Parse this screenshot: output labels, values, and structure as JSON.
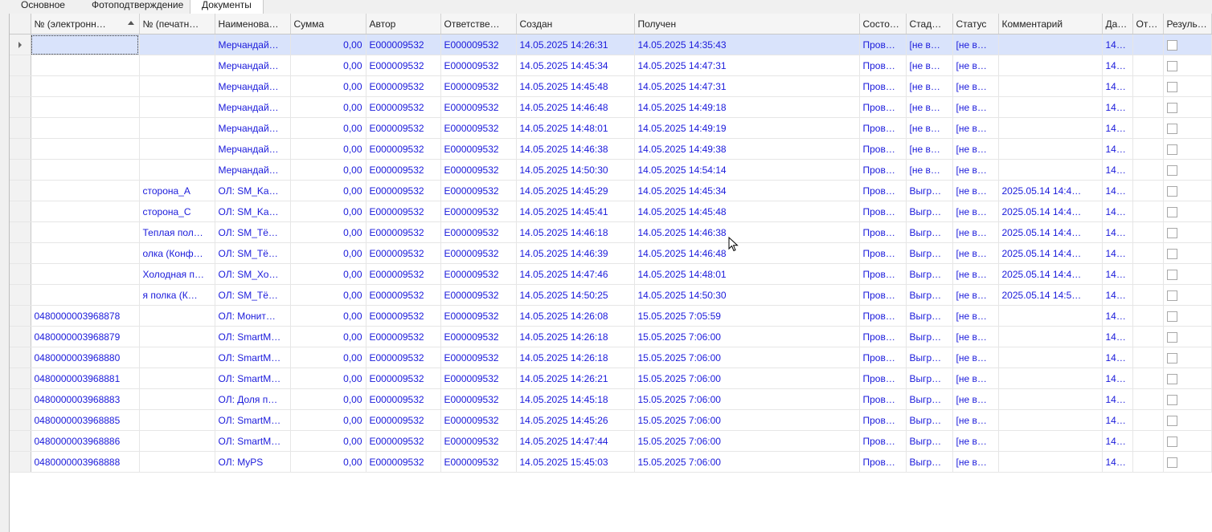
{
  "tabs": [
    {
      "label": "Основное"
    },
    {
      "label": "Фотоподтверждение"
    },
    {
      "label": "Документы"
    }
  ],
  "columns": [
    "№ (электронн…",
    "№ (печатн…",
    "Наименова…",
    "Сумма",
    "Автор",
    "Ответстве…",
    "Создан",
    "Получен",
    "Состо…",
    "Стад…",
    "Статус",
    "Комментарий",
    "Да…",
    "От…",
    "Резуль…"
  ],
  "rows": [
    {
      "e": "",
      "p": "",
      "name": "Мерчандай…",
      "sum": "0,00",
      "author": "E000009532",
      "resp": "E000009532",
      "created": "14.05.2025 14:26:31",
      "received": "14.05.2025 14:35:43",
      "state": "Пров…",
      "stage": "[не в…",
      "status": "[не в…",
      "comment": "",
      "date": "14…"
    },
    {
      "e": "",
      "p": "",
      "name": "Мерчандай…",
      "sum": "0,00",
      "author": "E000009532",
      "resp": "E000009532",
      "created": "14.05.2025 14:45:34",
      "received": "14.05.2025 14:47:31",
      "state": "Пров…",
      "stage": "[не в…",
      "status": "[не в…",
      "comment": "",
      "date": "14…"
    },
    {
      "e": "",
      "p": "",
      "name": "Мерчандай…",
      "sum": "0,00",
      "author": "E000009532",
      "resp": "E000009532",
      "created": "14.05.2025 14:45:48",
      "received": "14.05.2025 14:47:31",
      "state": "Пров…",
      "stage": "[не в…",
      "status": "[не в…",
      "comment": "",
      "date": "14…"
    },
    {
      "e": "",
      "p": "",
      "name": "Мерчандай…",
      "sum": "0,00",
      "author": "E000009532",
      "resp": "E000009532",
      "created": "14.05.2025 14:46:48",
      "received": "14.05.2025 14:49:18",
      "state": "Пров…",
      "stage": "[не в…",
      "status": "[не в…",
      "comment": "",
      "date": "14…"
    },
    {
      "e": "",
      "p": "",
      "name": "Мерчандай…",
      "sum": "0,00",
      "author": "E000009532",
      "resp": "E000009532",
      "created": "14.05.2025 14:48:01",
      "received": "14.05.2025 14:49:19",
      "state": "Пров…",
      "stage": "[не в…",
      "status": "[не в…",
      "comment": "",
      "date": "14…"
    },
    {
      "e": "",
      "p": "",
      "name": "Мерчандай…",
      "sum": "0,00",
      "author": "E000009532",
      "resp": "E000009532",
      "created": "14.05.2025 14:46:38",
      "received": "14.05.2025 14:49:38",
      "state": "Пров…",
      "stage": "[не в…",
      "status": "[не в…",
      "comment": "",
      "date": "14…"
    },
    {
      "e": "",
      "p": "",
      "name": "Мерчандай…",
      "sum": "0,00",
      "author": "E000009532",
      "resp": "E000009532",
      "created": "14.05.2025 14:50:30",
      "received": "14.05.2025 14:54:14",
      "state": "Пров…",
      "stage": "[не в…",
      "status": "[не в…",
      "comment": "",
      "date": "14…"
    },
    {
      "e": "",
      "p": "сторона_А",
      "name": "ОЛ: SM_Ka…",
      "sum": "0,00",
      "author": "E000009532",
      "resp": "E000009532",
      "created": "14.05.2025 14:45:29",
      "received": "14.05.2025 14:45:34",
      "state": "Пров…",
      "stage": "Выгр…",
      "status": "[не в…",
      "comment": "2025.05.14 14:4…",
      "date": "14…"
    },
    {
      "e": "",
      "p": "сторона_С",
      "name": "ОЛ: SM_Ka…",
      "sum": "0,00",
      "author": "E000009532",
      "resp": "E000009532",
      "created": "14.05.2025 14:45:41",
      "received": "14.05.2025 14:45:48",
      "state": "Пров…",
      "stage": "Выгр…",
      "status": "[не в…",
      "comment": "2025.05.14 14:4…",
      "date": "14…"
    },
    {
      "e": "",
      "p": "Теплая пол…",
      "name": "ОЛ: SM_Тё…",
      "sum": "0,00",
      "author": "E000009532",
      "resp": "E000009532",
      "created": "14.05.2025 14:46:18",
      "received": "14.05.2025 14:46:38",
      "state": "Пров…",
      "stage": "Выгр…",
      "status": "[не в…",
      "comment": "2025.05.14 14:4…",
      "date": "14…"
    },
    {
      "e": "",
      "p": "олка (Конф…",
      "name": "ОЛ: SM_Тё…",
      "sum": "0,00",
      "author": "E000009532",
      "resp": "E000009532",
      "created": "14.05.2025 14:46:39",
      "received": "14.05.2025 14:46:48",
      "state": "Пров…",
      "stage": "Выгр…",
      "status": "[не в…",
      "comment": "2025.05.14 14:4…",
      "date": "14…"
    },
    {
      "e": "",
      "p": "Холодная п…",
      "name": "ОЛ: SM_Хо…",
      "sum": "0,00",
      "author": "E000009532",
      "resp": "E000009532",
      "created": "14.05.2025 14:47:46",
      "received": "14.05.2025 14:48:01",
      "state": "Пров…",
      "stage": "Выгр…",
      "status": "[не в…",
      "comment": "2025.05.14 14:4…",
      "date": "14…"
    },
    {
      "e": "",
      "p": "я полка (К…",
      "name": "ОЛ: SM_Тё…",
      "sum": "0,00",
      "author": "E000009532",
      "resp": "E000009532",
      "created": "14.05.2025 14:50:25",
      "received": "14.05.2025 14:50:30",
      "state": "Пров…",
      "stage": "Выгр…",
      "status": "[не в…",
      "comment": "2025.05.14 14:5…",
      "date": "14…"
    },
    {
      "e": "0480000003968878",
      "p": "",
      "name": "ОЛ: Монит…",
      "sum": "0,00",
      "author": "E000009532",
      "resp": "E000009532",
      "created": "14.05.2025 14:26:08",
      "received": "15.05.2025 7:05:59",
      "state": "Пров…",
      "stage": "Выгр…",
      "status": "[не в…",
      "comment": "",
      "date": "14…"
    },
    {
      "e": "0480000003968879",
      "p": "",
      "name": "ОЛ: SmartM…",
      "sum": "0,00",
      "author": "E000009532",
      "resp": "E000009532",
      "created": "14.05.2025 14:26:18",
      "received": "15.05.2025 7:06:00",
      "state": "Пров…",
      "stage": "Выгр…",
      "status": "[не в…",
      "comment": "",
      "date": "14…"
    },
    {
      "e": "0480000003968880",
      "p": "",
      "name": "ОЛ: SmartM…",
      "sum": "0,00",
      "author": "E000009532",
      "resp": "E000009532",
      "created": "14.05.2025 14:26:18",
      "received": "15.05.2025 7:06:00",
      "state": "Пров…",
      "stage": "Выгр…",
      "status": "[не в…",
      "comment": "",
      "date": "14…"
    },
    {
      "e": "0480000003968881",
      "p": "",
      "name": "ОЛ: SmartM…",
      "sum": "0,00",
      "author": "E000009532",
      "resp": "E000009532",
      "created": "14.05.2025 14:26:21",
      "received": "15.05.2025 7:06:00",
      "state": "Пров…",
      "stage": "Выгр…",
      "status": "[не в…",
      "comment": "",
      "date": "14…"
    },
    {
      "e": "0480000003968883",
      "p": "",
      "name": "ОЛ: Доля п…",
      "sum": "0,00",
      "author": "E000009532",
      "resp": "E000009532",
      "created": "14.05.2025 14:45:18",
      "received": "15.05.2025 7:06:00",
      "state": "Пров…",
      "stage": "Выгр…",
      "status": "[не в…",
      "comment": "",
      "date": "14…"
    },
    {
      "e": "0480000003968885",
      "p": "",
      "name": "ОЛ: SmartM…",
      "sum": "0,00",
      "author": "E000009532",
      "resp": "E000009532",
      "created": "14.05.2025 14:45:26",
      "received": "15.05.2025 7:06:00",
      "state": "Пров…",
      "stage": "Выгр…",
      "status": "[не в…",
      "comment": "",
      "date": "14…"
    },
    {
      "e": "0480000003968886",
      "p": "",
      "name": "ОЛ: SmartM…",
      "sum": "0,00",
      "author": "E000009532",
      "resp": "E000009532",
      "created": "14.05.2025 14:47:44",
      "received": "15.05.2025 7:06:00",
      "state": "Пров…",
      "stage": "Выгр…",
      "status": "[не в…",
      "comment": "",
      "date": "14…"
    },
    {
      "e": "0480000003968888",
      "p": "",
      "name": "ОЛ: MyPS",
      "sum": "0,00",
      "author": "E000009532",
      "resp": "E000009532",
      "created": "14.05.2025 15:45:03",
      "received": "15.05.2025 7:06:00",
      "state": "Пров…",
      "stage": "Выгр…",
      "status": "[не в…",
      "comment": "",
      "date": "14…"
    }
  ],
  "colors": {
    "link_text": "#1a1adb",
    "selected_row": "#d9e3fb",
    "header_bg": "#f5f5f5"
  }
}
